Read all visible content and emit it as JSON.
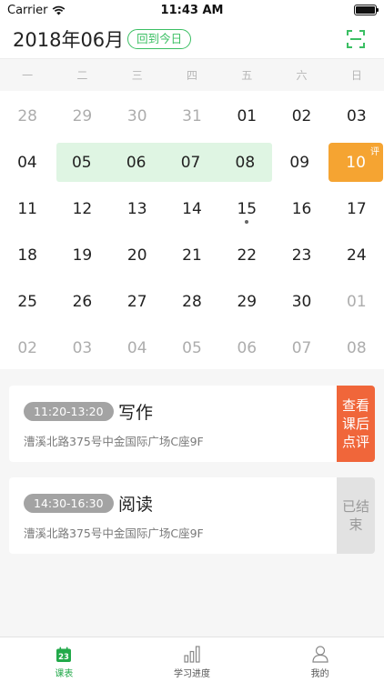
{
  "status": {
    "carrier": "Carrier",
    "time": "11:43 AM"
  },
  "header": {
    "month": "2018年06月",
    "today_label": "回到今日"
  },
  "weekdays": [
    "一",
    "二",
    "三",
    "四",
    "五",
    "六",
    "日"
  ],
  "calendar": {
    "rows": [
      [
        "28",
        "29",
        "30",
        "31",
        "01",
        "02",
        "03"
      ],
      [
        "04",
        "05",
        "06",
        "07",
        "08",
        "09",
        "10"
      ],
      [
        "11",
        "12",
        "13",
        "14",
        "15",
        "16",
        "17"
      ],
      [
        "18",
        "19",
        "20",
        "21",
        "22",
        "23",
        "24"
      ],
      [
        "25",
        "26",
        "27",
        "28",
        "29",
        "30",
        "01"
      ],
      [
        "02",
        "03",
        "04",
        "05",
        "06",
        "07",
        "08"
      ]
    ],
    "review_badge": "评"
  },
  "courses": [
    {
      "time": "11:20-13:20",
      "name": "写作",
      "address": "漕溪北路375号中金国际广场C座9F",
      "action": "查看课后点评"
    },
    {
      "time": "14:30-16:30",
      "name": "阅读",
      "address": "漕溪北路375号中金国际广场C座9F",
      "action": "已结束"
    }
  ],
  "tabs": [
    {
      "label": "课表",
      "icon": "calendar-icon",
      "icon_text": "23"
    },
    {
      "label": "学习进度",
      "icon": "bar-chart-icon"
    },
    {
      "label": "我的",
      "icon": "user-icon"
    }
  ],
  "colors": {
    "accent": "#22a94a",
    "review": "#f0663a",
    "reviewed_day": "#f5a432",
    "range": "#dff5e3"
  }
}
